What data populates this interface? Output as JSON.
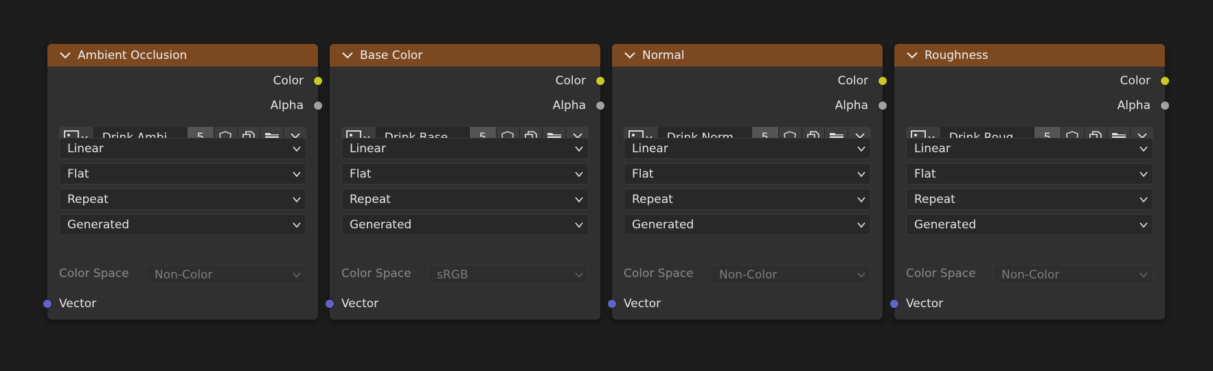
{
  "colors": {
    "header": "#7b4820",
    "node_body": "#303030",
    "socket_color": "#c8c829",
    "socket_alpha": "#a1a1a1",
    "socket_vector": "#6363c7"
  },
  "nodes": [
    {
      "title": "Ambient Occlusion",
      "outputs": [
        "Color",
        "Alpha"
      ],
      "image_name": "Drink.Ambi...",
      "users": "5",
      "interpolation": "Linear",
      "projection": "Flat",
      "extension": "Repeat",
      "source": "Generated",
      "color_space_label": "Color Space",
      "color_space": "Non-Color",
      "input": "Vector"
    },
    {
      "title": "Base Color",
      "outputs": [
        "Color",
        "Alpha"
      ],
      "image_name": "Drink.Base ...",
      "users": "5",
      "interpolation": "Linear",
      "projection": "Flat",
      "extension": "Repeat",
      "source": "Generated",
      "color_space_label": "Color Space",
      "color_space": "sRGB",
      "input": "Vector"
    },
    {
      "title": "Normal",
      "outputs": [
        "Color",
        "Alpha"
      ],
      "image_name": "Drink.Norm...",
      "users": "5",
      "interpolation": "Linear",
      "projection": "Flat",
      "extension": "Repeat",
      "source": "Generated",
      "color_space_label": "Color Space",
      "color_space": "Non-Color",
      "input": "Vector"
    },
    {
      "title": "Roughness",
      "outputs": [
        "Color",
        "Alpha"
      ],
      "image_name": "Drink.Roug...",
      "users": "5",
      "interpolation": "Linear",
      "projection": "Flat",
      "extension": "Repeat",
      "source": "Generated",
      "color_space_label": "Color Space",
      "color_space": "Non-Color",
      "input": "Vector"
    }
  ]
}
